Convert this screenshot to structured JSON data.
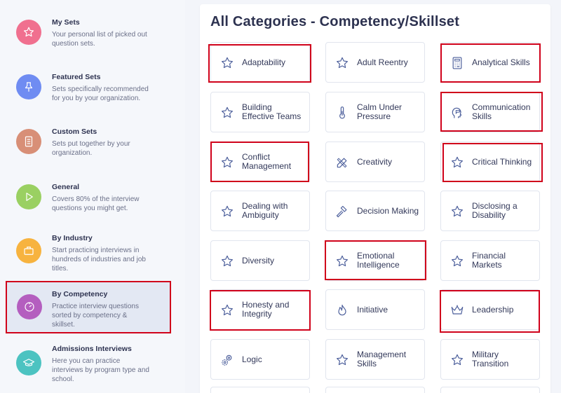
{
  "sidebar": {
    "items": [
      {
        "title": "My Sets",
        "desc1": "Your personal list of picked out",
        "desc2": "question sets.",
        "desc3": "",
        "color": "#f0708f",
        "icon": "star-icon"
      },
      {
        "title": "Featured Sets",
        "desc1": "Sets specifically recommended",
        "desc2": "for you by your organization.",
        "desc3": "",
        "color": "#6f8cf2",
        "icon": "pin-icon"
      },
      {
        "title": "Custom Sets",
        "desc1": "Sets put together by your",
        "desc2": "organization.",
        "desc3": "",
        "color": "#d88f77",
        "icon": "list-icon"
      },
      {
        "title": "General",
        "desc1": "Covers 80% of the interview",
        "desc2": "questions you might get.",
        "desc3": "",
        "color": "#9ad062",
        "icon": "play-icon"
      },
      {
        "title": "By Industry",
        "desc1": "Start practicing interviews in",
        "desc2": "hundreds of industries and job",
        "desc3": "titles.",
        "color": "#f7b33f",
        "icon": "briefcase-icon"
      },
      {
        "title": "By Competency",
        "desc1": "Practice interview questions",
        "desc2": "sorted by competency &",
        "desc3": "skillset.",
        "color": "#b45ebf",
        "icon": "gauge-icon"
      },
      {
        "title": "Admissions Interviews",
        "desc1": "Here you can practice",
        "desc2": "interviews by program type and",
        "desc3": "school.",
        "color": "#4cc3c1",
        "icon": "graduation-cap-icon"
      }
    ]
  },
  "main": {
    "title": "All Categories - Competency/Skillset",
    "tiles": [
      {
        "line1": "Adaptability",
        "line2": "",
        "icon": "star-icon"
      },
      {
        "line1": "Adult Reentry",
        "line2": "",
        "icon": "star-icon"
      },
      {
        "line1": "Analytical Skills",
        "line2": "",
        "icon": "calculator-icon"
      },
      {
        "line1": "Building",
        "line2": "Effective Teams",
        "icon": "star-icon"
      },
      {
        "line1": "Calm Under",
        "line2": "Pressure",
        "icon": "thermometer-icon"
      },
      {
        "line1": "Communication",
        "line2": "Skills",
        "icon": "speech-head-icon"
      },
      {
        "line1": "Conflict",
        "line2": "Management",
        "icon": "star-icon"
      },
      {
        "line1": "Creativity",
        "line2": "",
        "icon": "pencil-ruler-icon"
      },
      {
        "line1": "Critical Thinking",
        "line2": "",
        "icon": "star-icon"
      },
      {
        "line1": "Dealing with",
        "line2": "Ambiguity",
        "icon": "star-icon"
      },
      {
        "line1": "Decision Making",
        "line2": "",
        "icon": "gavel-icon"
      },
      {
        "line1": "Disclosing a",
        "line2": "Disability",
        "icon": "star-icon"
      },
      {
        "line1": "Diversity",
        "line2": "",
        "icon": "star-icon"
      },
      {
        "line1": "Emotional",
        "line2": "Intelligence",
        "icon": "star-icon"
      },
      {
        "line1": "Financial",
        "line2": "Markets",
        "icon": "star-icon"
      },
      {
        "line1": "Honesty and",
        "line2": "Integrity",
        "icon": "star-icon"
      },
      {
        "line1": "Initiative",
        "line2": "",
        "icon": "flame-icon"
      },
      {
        "line1": "Leadership",
        "line2": "",
        "icon": "crown-icon"
      },
      {
        "line1": "Logic",
        "line2": "",
        "icon": "gears-icon"
      },
      {
        "line1": "Management",
        "line2": "Skills",
        "icon": "star-icon"
      },
      {
        "line1": "Military",
        "line2": "Transition",
        "icon": "star-icon"
      }
    ]
  },
  "colors": {
    "accent_outline": "#d0021b",
    "icon_stroke": "#4a5d9a"
  }
}
